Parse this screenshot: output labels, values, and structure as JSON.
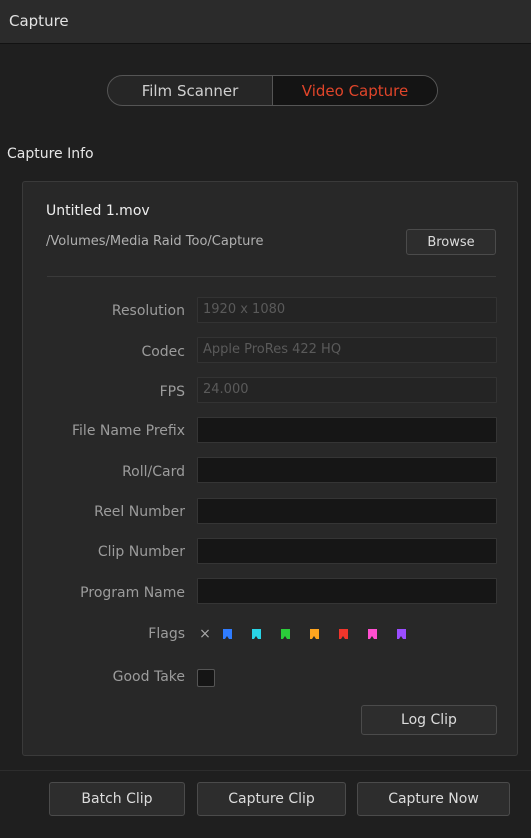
{
  "window": {
    "title": "Capture"
  },
  "mode_switch": {
    "left_label": "Film Scanner",
    "right_label": "Video Capture",
    "active": "Video Capture",
    "active_color": "#e0452a"
  },
  "section": {
    "title": "Capture Info"
  },
  "file": {
    "name": "Untitled 1.mov",
    "path": "/Volumes/Media Raid Too/Capture",
    "browse_label": "Browse"
  },
  "fields": {
    "resolution": {
      "label": "Resolution",
      "value": "1920 x 1080"
    },
    "codec": {
      "label": "Codec",
      "value": "Apple ProRes 422 HQ"
    },
    "fps": {
      "label": "FPS",
      "value": "24.000"
    },
    "file_name_prefix": {
      "label": "File Name Prefix",
      "value": ""
    },
    "roll_card": {
      "label": "Roll/Card",
      "value": ""
    },
    "reel_number": {
      "label": "Reel Number",
      "value": ""
    },
    "clip_number": {
      "label": "Clip Number",
      "value": ""
    },
    "program_name": {
      "label": "Program Name",
      "value": ""
    }
  },
  "flags": {
    "label": "Flags",
    "clear_symbol": "×",
    "colors": [
      "#2f7cff",
      "#29d4e6",
      "#2bcd3a",
      "#ffa51f",
      "#f0352b",
      "#ff4fd0",
      "#9b4dff"
    ]
  },
  "good_take": {
    "label": "Good Take",
    "checked": false
  },
  "buttons": {
    "log_clip": "Log Clip",
    "batch_clip": "Batch Clip",
    "capture_clip": "Capture Clip",
    "capture_now": "Capture Now"
  }
}
